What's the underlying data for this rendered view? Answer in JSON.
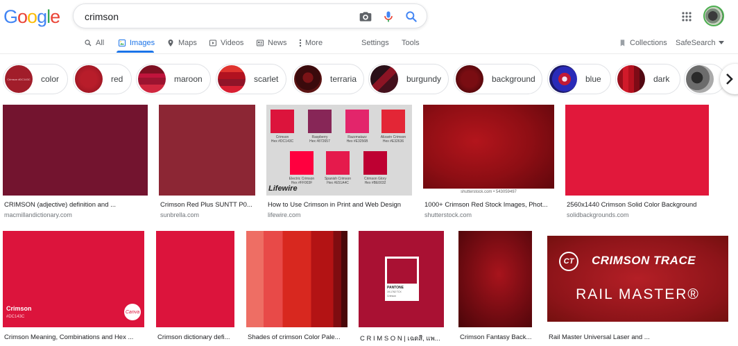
{
  "logo": {
    "letters": [
      "G",
      "o",
      "o",
      "g",
      "l",
      "e"
    ],
    "colors": [
      "#4285f4",
      "#ea4335",
      "#fbbc05",
      "#4285f4",
      "#34a853",
      "#ea4335"
    ]
  },
  "search": {
    "value": "crimson"
  },
  "tabs": [
    {
      "label": "All",
      "icon": "search-icon"
    },
    {
      "label": "Images",
      "icon": "image-icon"
    },
    {
      "label": "Maps",
      "icon": "map-pin-icon"
    },
    {
      "label": "Videos",
      "icon": "play-icon"
    },
    {
      "label": "News",
      "icon": "news-icon"
    },
    {
      "label": "More",
      "icon": "more-vert-icon"
    },
    {
      "label": "Settings"
    },
    {
      "label": "Tools"
    }
  ],
  "right_tools": {
    "collections": "Collections",
    "safesearch": "SafeSearch"
  },
  "chips": [
    {
      "label": "color",
      "thumb_text": "Crimson #DC143C"
    },
    {
      "label": "red"
    },
    {
      "label": "maroon"
    },
    {
      "label": "scarlet"
    },
    {
      "label": "terraria"
    },
    {
      "label": "burgundy"
    },
    {
      "label": "background"
    },
    {
      "label": "blue"
    },
    {
      "label": "dark"
    }
  ],
  "results": [
    {
      "title": "CRIMSON (adjective) definition and ...",
      "source": "macmillandictionary.com"
    },
    {
      "title": "Crimson Red Plus SUNTT P0...",
      "source": "sunbrella.com"
    },
    {
      "title": "How to Use Crimson in Print and Web Design",
      "source": "lifewire.com",
      "swatches": [
        {
          "name": "Crimson",
          "hex": "Hex #DC143C",
          "color": "#dc143c"
        },
        {
          "name": "Raspberry",
          "hex": "Hex #872657",
          "color": "#872657"
        },
        {
          "name": "Razzmatazz",
          "hex": "Hex #E3256B",
          "color": "#e3256b"
        },
        {
          "name": "Alizarin Crimson",
          "hex": "Hex #E32636",
          "color": "#e32636"
        },
        {
          "name": "Electric Crimson",
          "hex": "Hex #FF003F",
          "color": "#ff003f"
        },
        {
          "name": "Spanish Crimson",
          "hex": "Hex #E51A4C",
          "color": "#e51a4c"
        },
        {
          "name": "Crimson Glory",
          "hex": "Hex #BE0032",
          "color": "#be0032"
        }
      ],
      "brand": "Lifewire"
    },
    {
      "title": "1000+ Crimson Red Stock Images, Phot...",
      "source": "shutterstock.com",
      "caption": "shutterstock.com • 543059497"
    },
    {
      "title": "2560x1440 Crimson Solid Color Background",
      "source": "solidbackgrounds.com"
    },
    {
      "title": "Crimson Meaning, Combinations and Hex ...",
      "source": "",
      "overlay_name": "Crimson",
      "overlay_hex": "#DC143C",
      "badge": "Canva"
    },
    {
      "title": "Crimson dictionary defi...",
      "source": ""
    },
    {
      "title": "Shades of crimson Color Pale...",
      "source": ""
    },
    {
      "title": "C R I M S O N | เฉดสี, แพ...",
      "source": "",
      "card_brand": "PANTONE",
      "card_code": "19-1762 TCX",
      "card_name": "Crimson"
    },
    {
      "title": "Crimson Fantasy Back...",
      "source": ""
    },
    {
      "title": "Rail Master Universal Laser and ...",
      "source": "",
      "logo_text": "CRIMSON TRACE",
      "logo_mark": "CT",
      "product": "RAIL MASTER®"
    }
  ]
}
